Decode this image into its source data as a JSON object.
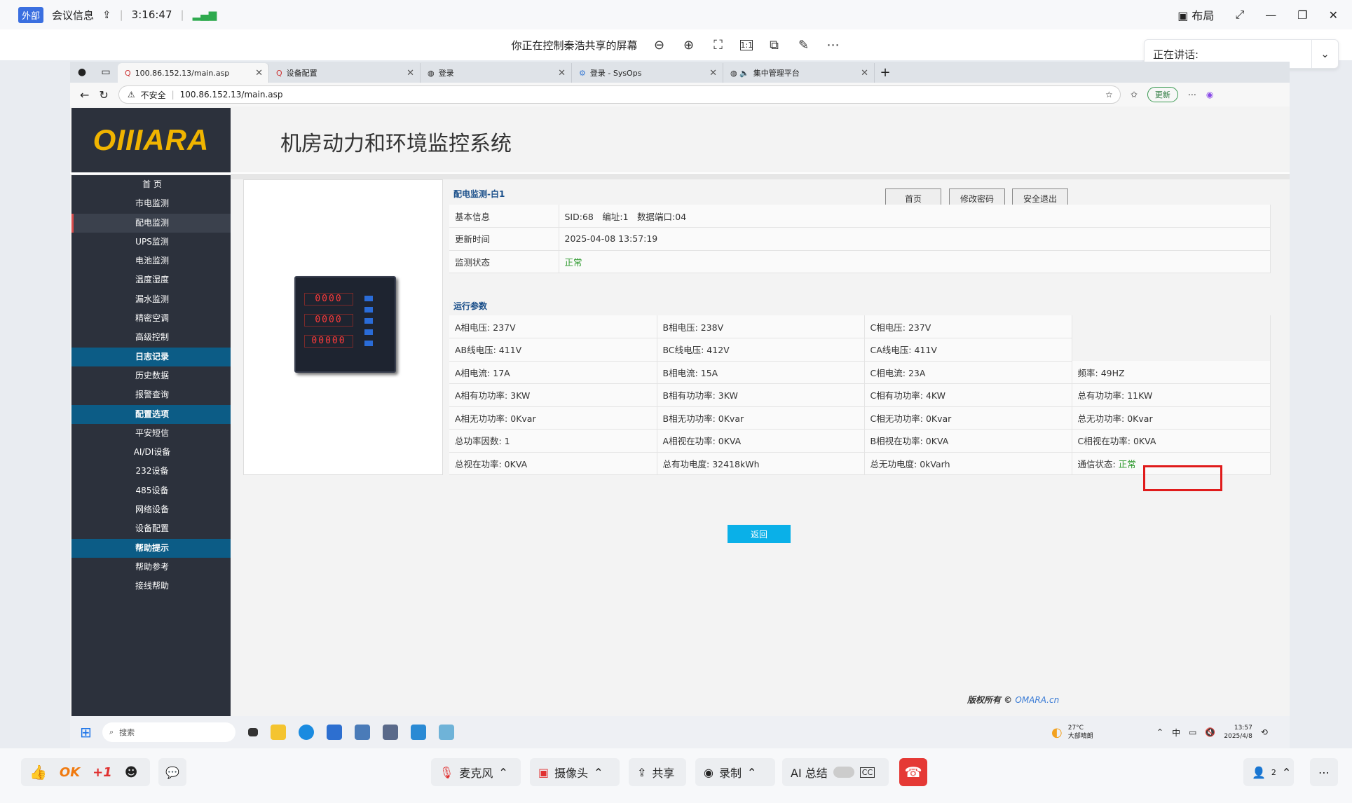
{
  "meeting": {
    "tag": "外部",
    "info": "会议信息",
    "time": "3:16:47",
    "layout": "布局",
    "share_status": "你正在控制秦浩共享的屏幕",
    "speaking": "正在讲话:",
    "bottom": {
      "mic": "麦克风",
      "camera": "摄像头",
      "share": "共享",
      "record": "录制",
      "ai": "AI 总结",
      "ok": "OK",
      "plus1": "+1",
      "participants": "2"
    }
  },
  "browser": {
    "tabs": [
      "100.86.152.13/main.asp",
      "设备配置",
      "登录",
      "登录 - SysOps",
      "集中管理平台"
    ],
    "insecure": "不安全",
    "url": "100.86.152.13/main.asp",
    "update": "更新"
  },
  "app": {
    "logo": "OIIIARA",
    "title": "机房动力和环境监控系统",
    "header_buttons": [
      "首页",
      "修改密码",
      "安全退出"
    ],
    "nav": [
      {
        "label": "首 页",
        "type": "item"
      },
      {
        "label": "市电监测",
        "type": "item"
      },
      {
        "label": "配电监测",
        "type": "sel"
      },
      {
        "label": "UPS监测",
        "type": "item"
      },
      {
        "label": "电池监测",
        "type": "item"
      },
      {
        "label": "温度湿度",
        "type": "item"
      },
      {
        "label": "漏水监测",
        "type": "item"
      },
      {
        "label": "精密空调",
        "type": "item"
      },
      {
        "label": "高级控制",
        "type": "item"
      },
      {
        "label": "日志记录",
        "type": "hdr"
      },
      {
        "label": "历史数据",
        "type": "item"
      },
      {
        "label": "报警查询",
        "type": "item"
      },
      {
        "label": "配置选项",
        "type": "hdr"
      },
      {
        "label": "平安短信",
        "type": "item"
      },
      {
        "label": "AI/DI设备",
        "type": "item"
      },
      {
        "label": "232设备",
        "type": "item"
      },
      {
        "label": "485设备",
        "type": "item"
      },
      {
        "label": "网络设备",
        "type": "item"
      },
      {
        "label": "设备配置",
        "type": "item"
      },
      {
        "label": "帮助提示",
        "type": "hdr"
      },
      {
        "label": "帮助参考",
        "type": "item"
      },
      {
        "label": "接线帮助",
        "type": "item"
      }
    ],
    "device_title": "配电监测-白1",
    "basic": [
      [
        "基本信息",
        "SID:68　编址:1　数据端口:04"
      ],
      [
        "更新时间",
        "2025-04-08 13:57:19"
      ],
      [
        "监测状态",
        "正常"
      ]
    ],
    "run_title": "运行参数",
    "params": [
      [
        "A相电压: 237V",
        "B相电压: 238V",
        "C相电压: 237V",
        ""
      ],
      [
        "AB线电压: 411V",
        "BC线电压: 412V",
        "CA线电压: 411V",
        ""
      ],
      [
        "A相电流: 17A",
        "B相电流: 15A",
        "C相电流: 23A",
        "频率: 49HZ"
      ],
      [
        "A相有功功率: 3KW",
        "B相有功功率: 3KW",
        "C相有功功率: 4KW",
        "总有功功率: 11KW"
      ],
      [
        "A相无功功率: 0Kvar",
        "B相无功功率: 0Kvar",
        "C相无功功率: 0Kvar",
        "总无功功率: 0Kvar"
      ],
      [
        "总功率因数: 1",
        "A相视在功率: 0KVA",
        "B相视在功率: 0KVA",
        "C相视在功率: 0KVA"
      ],
      [
        "总视在功率: 0KVA",
        "总有功电度: 32418kWh",
        "总无功电度: 0kVarh",
        "通信状态: "
      ]
    ],
    "comm_ok": "正常",
    "return": "返回",
    "copyright": "版权所有 ©",
    "copyright_link": "OMARA.cn",
    "device_digits": [
      "0000",
      "0000",
      "00000"
    ]
  },
  "taskbar": {
    "search": "搜索",
    "weather_temp": "27°C",
    "weather": "大部晴朗",
    "ime": "中",
    "clock_time": "13:57",
    "clock_date": "2025/4/8"
  }
}
